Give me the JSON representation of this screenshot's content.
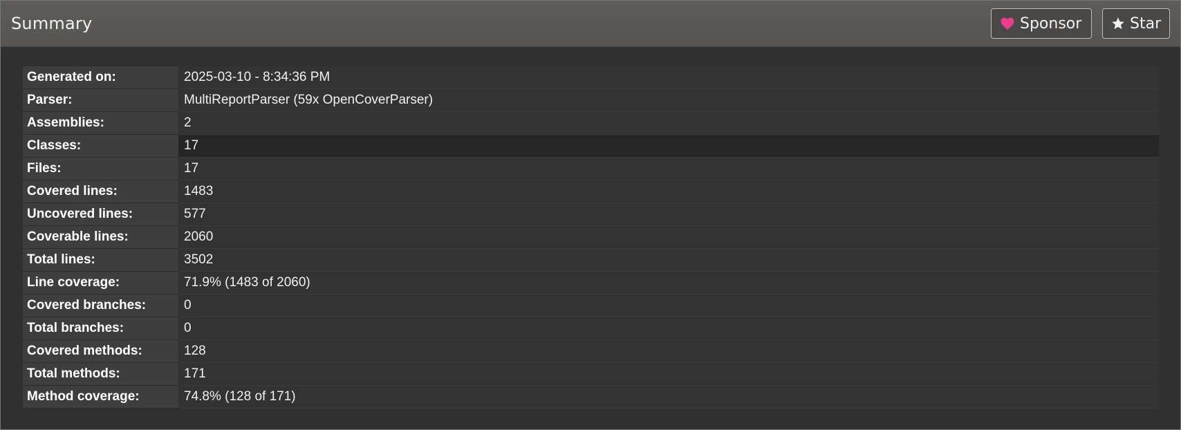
{
  "header": {
    "title": "Summary",
    "sponsor_label": "Sponsor",
    "star_label": "Star",
    "sponsor_icon": "heart-icon",
    "star_icon": "star-icon",
    "heart_color": "#e83e8c"
  },
  "summary": {
    "rows": [
      {
        "label": "Generated on:",
        "value": "2025-03-10 - 8:34:36 PM"
      },
      {
        "label": "Parser:",
        "value": "MultiReportParser (59x OpenCoverParser)"
      },
      {
        "label": "Assemblies:",
        "value": "2"
      },
      {
        "label": "Classes:",
        "value": "17"
      },
      {
        "label": "Files:",
        "value": "17"
      },
      {
        "label": "Covered lines:",
        "value": "1483"
      },
      {
        "label": "Uncovered lines:",
        "value": "577"
      },
      {
        "label": "Coverable lines:",
        "value": "2060"
      },
      {
        "label": "Total lines:",
        "value": "3502"
      },
      {
        "label": "Line coverage:",
        "value": "71.9% (1483 of 2060)"
      },
      {
        "label": "Covered branches:",
        "value": "0"
      },
      {
        "label": "Total branches:",
        "value": "0"
      },
      {
        "label": "Covered methods:",
        "value": "128"
      },
      {
        "label": "Total methods:",
        "value": "171"
      },
      {
        "label": "Method coverage:",
        "value": "74.8% (128 of 171)"
      }
    ]
  }
}
